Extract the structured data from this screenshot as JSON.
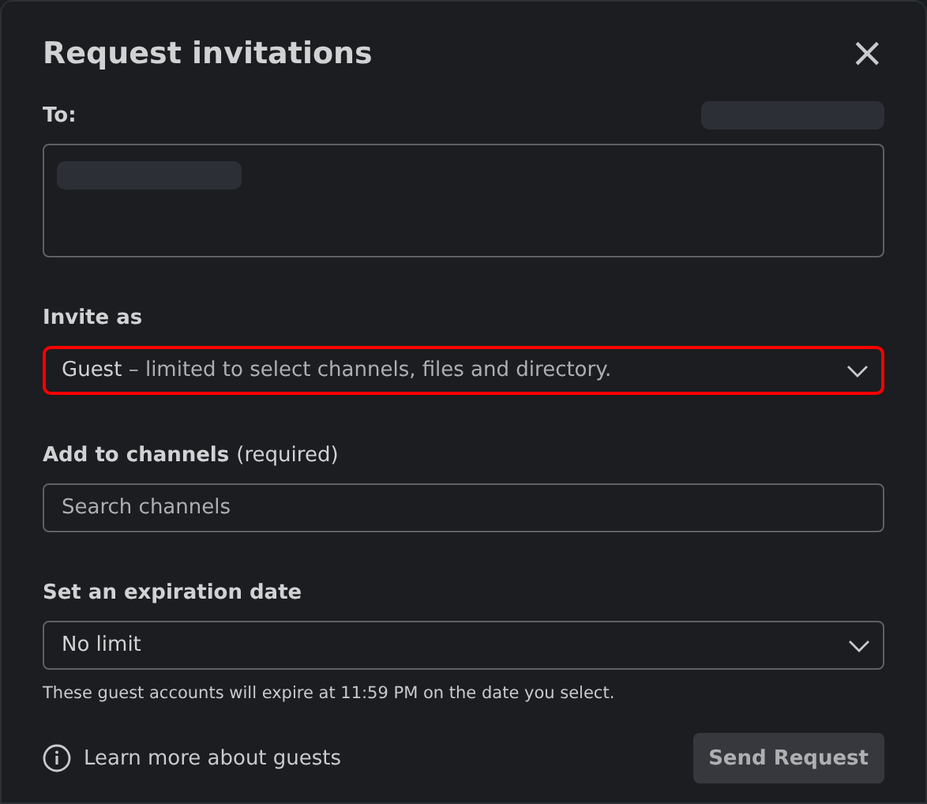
{
  "dialog": {
    "title": "Request invitations",
    "close": "×"
  },
  "to": {
    "label": "To:"
  },
  "invite_as": {
    "label": "Invite as",
    "value_bold": "Guest",
    "value_rest": " – limited to select channels, files and directory.",
    "highlighted": true
  },
  "channels": {
    "label": "Add to channels",
    "label_suffix": "(required)",
    "placeholder": "Search channels"
  },
  "expiration": {
    "label": "Set an expiration date",
    "value": "No limit",
    "note": "These guest accounts will expire at 11:59 PM on the date you select."
  },
  "footer": {
    "link": "Learn more about guests",
    "button": "Send Request"
  }
}
